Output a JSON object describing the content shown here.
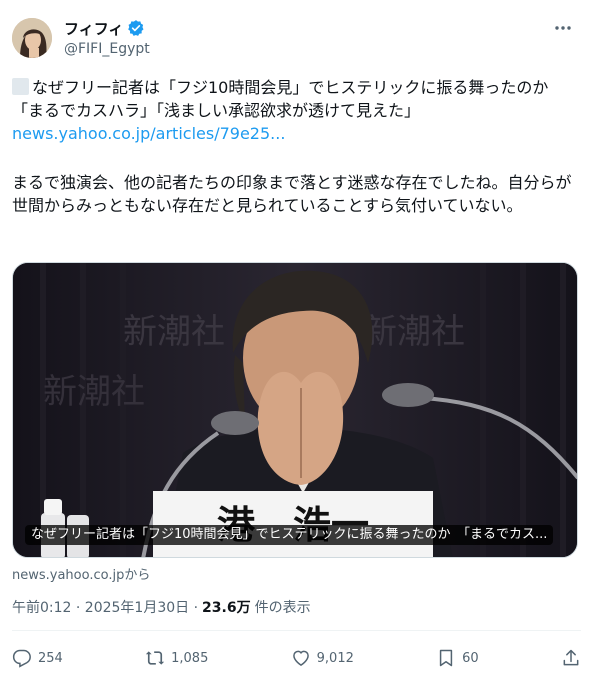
{
  "author": {
    "display_name": "フィフィ",
    "handle": "@FIFI_Egypt",
    "verified_color": "#1d9bf0"
  },
  "menu_icon": "more-dots-icon",
  "tweet": {
    "line1": "なぜフリー記者は「フジ10時間会見」でヒステリックに振る舞ったのか　「まるでカスハラ」「浅ましい承認欲求が透けて見えた」",
    "link": "news.yahoo.co.jp/articles/79e25...",
    "comment": "まるで独演会、他の記者たちの印象まで落とす迷惑な存在でしたね。自分らが世間からみっともない存在だと見られていることすら気付いていない。"
  },
  "media": {
    "caption": "なぜフリー記者は「フジ10時間会見」でヒステリックに振る舞ったのか　「まるでカス...",
    "nameplate": "港　浩一",
    "watermark": "新潮社"
  },
  "source": "news.yahoo.co.jpから",
  "meta": {
    "timestamp": "午前0:12 · 2025年1月30日 ·",
    "views_count": "23.6万",
    "views_label": "件の表示"
  },
  "actions": {
    "replies": "254",
    "reposts": "1,085",
    "likes": "9,012",
    "bookmarks": "60"
  },
  "colors": {
    "text": "#0f1419",
    "secondary": "#536471",
    "link": "#1d9bf0"
  }
}
